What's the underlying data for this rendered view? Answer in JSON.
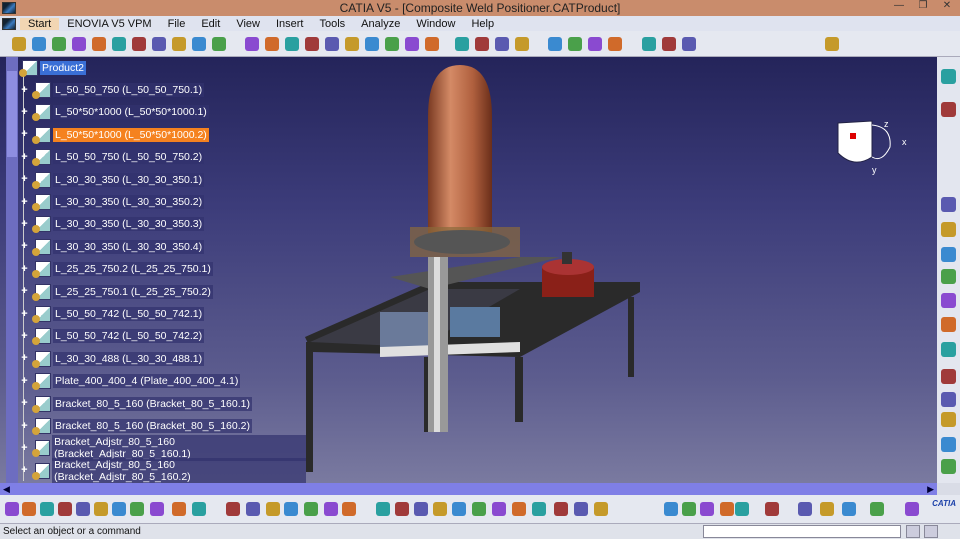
{
  "window": {
    "title": "CATIA V5 - [Composite Weld Positioner.CATProduct]",
    "buttons": [
      "minimize",
      "restore",
      "close"
    ]
  },
  "menu": [
    "Start",
    "ENOVIA V5 VPM",
    "File",
    "Edit",
    "View",
    "Insert",
    "Tools",
    "Analyze",
    "Window",
    "Help"
  ],
  "tree": {
    "root": "Product2",
    "items": [
      {
        "label": "L_50_50_750 (L_50_50_750.1)",
        "selected": false
      },
      {
        "label": "L_50*50*1000 (L_50*50*1000.1)",
        "selected": false
      },
      {
        "label": "L_50*50*1000 (L_50*50*1000.2)",
        "selected": true
      },
      {
        "label": "L_50_50_750 (L_50_50_750.2)",
        "selected": false
      },
      {
        "label": "L_30_30_350 (L_30_30_350.1)",
        "selected": false
      },
      {
        "label": "L_30_30_350 (L_30_30_350.2)",
        "selected": false
      },
      {
        "label": "L_30_30_350 (L_30_30_350.3)",
        "selected": false
      },
      {
        "label": "L_30_30_350 (L_30_30_350.4)",
        "selected": false
      },
      {
        "label": "L_25_25_750.2 (L_25_25_750.1)",
        "selected": false
      },
      {
        "label": "L_25_25_750.1 (L_25_25_750.2)",
        "selected": false
      },
      {
        "label": "L_50_50_742 (L_50_50_742.1)",
        "selected": false
      },
      {
        "label": "L_50_50_742 (L_50_50_742.2)",
        "selected": false
      },
      {
        "label": "L_30_30_488 (L_30_30_488.1)",
        "selected": false
      },
      {
        "label": "Plate_400_400_4 (Plate_400_400_4.1)",
        "selected": false
      },
      {
        "label": "Bracket_80_5_160 (Bracket_80_5_160.1)",
        "selected": false
      },
      {
        "label": "Bracket_80_5_160 (Bracket_80_5_160.2)",
        "selected": false
      },
      {
        "label": "Bracket_Adjstr_80_5_160 (Bracket_Adjstr_80_5_160.1)",
        "selected": false
      },
      {
        "label": "Bracket_Adjstr_80_5_160 (Bracket_Adjstr_80_5_160.2)",
        "selected": false
      }
    ]
  },
  "compass": {
    "x": "x",
    "y": "y",
    "z": "z"
  },
  "status": {
    "message": "Select an object or a command",
    "command_input": ""
  },
  "brand": "CATIA",
  "colors": {
    "selection": "#f5821f",
    "titlebar": "#c98c6c",
    "scrollbar": "#7f7fe6"
  }
}
